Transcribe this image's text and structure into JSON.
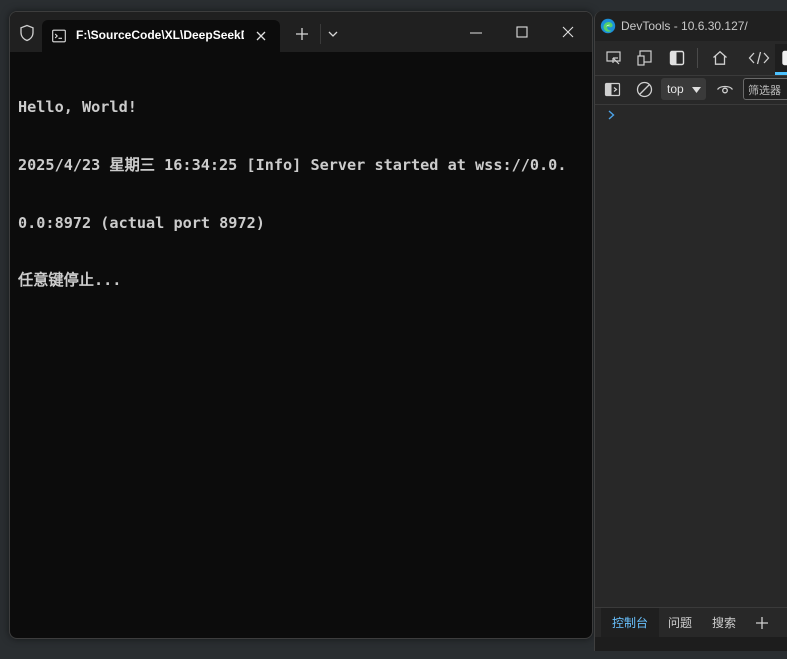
{
  "terminal": {
    "tab_title": "F:\\SourceCode\\XL\\DeepSeekD",
    "lines": [
      "Hello, World!",
      "2025/4/23 星期三 16:34:25 [Info] Server started at wss://0.0.",
      "0.0:8972 (actual port 8972)",
      "任意键停止..."
    ],
    "colors": {
      "background": "#0c0c0c",
      "text": "#cccccc",
      "titlebar": "#202020"
    }
  },
  "devtools": {
    "title": "DevTools - 10.6.30.127/",
    "context": "top",
    "filter_placeholder": "筛选器",
    "drawer_tabs": [
      "控制台",
      "问题",
      "搜索"
    ],
    "active_drawer_tab": "控制台",
    "colors": {
      "accent": "#4cc2ff",
      "background": "#282828"
    }
  },
  "icons": {
    "terminal_shield": "shield-icon",
    "tab": "terminal-icon",
    "tab_close": "close-icon",
    "new_tab": "plus-icon",
    "dropdown": "chevron-down-icon",
    "minimize": "minimize-icon",
    "maximize": "maximize-icon",
    "close": "close-icon",
    "edge": "edge-logo-icon",
    "inspect": "inspect-icon",
    "device": "device-emulation-icon",
    "dock": "dock-side-icon",
    "home": "home-icon",
    "elements": "code-icon",
    "sidebar": "sidebar-toggle-icon",
    "clear": "clear-console-icon",
    "eye": "eye-icon",
    "prompt": "chevron-right-icon",
    "add_tab": "plus-icon"
  }
}
